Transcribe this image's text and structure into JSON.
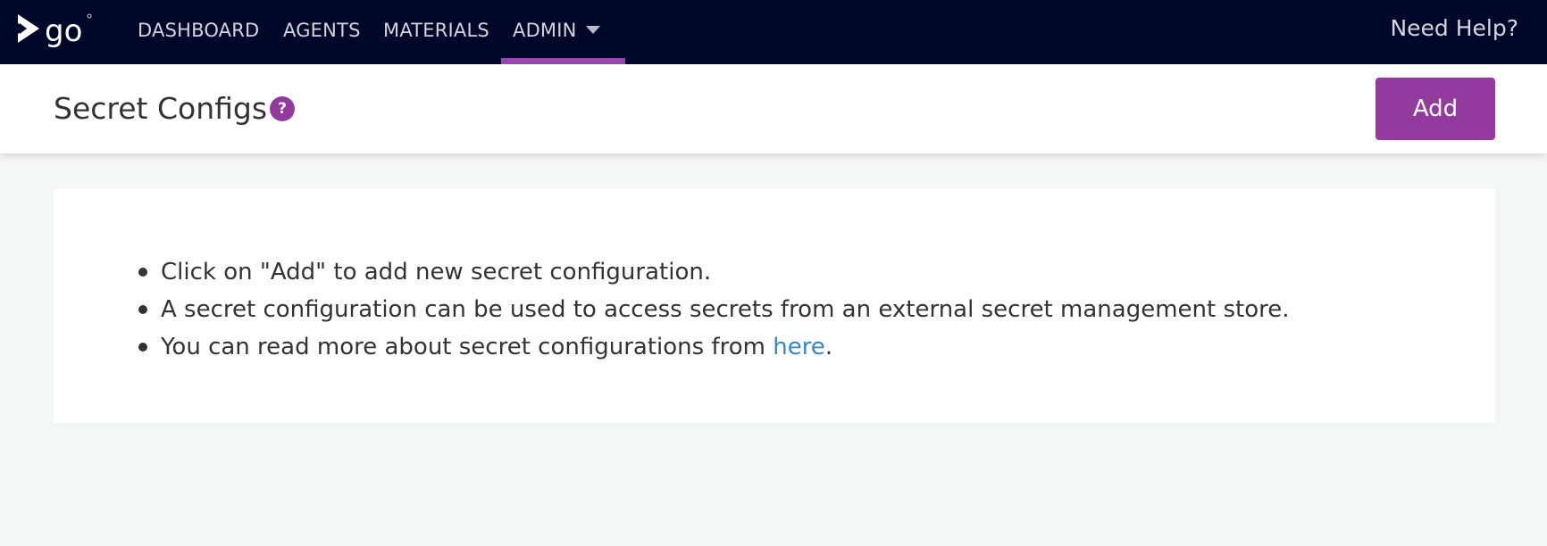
{
  "nav": {
    "logo_text": "go",
    "items": [
      {
        "label": "DASHBOARD"
      },
      {
        "label": "AGENTS"
      },
      {
        "label": "MATERIALS"
      },
      {
        "label": "ADMIN"
      }
    ],
    "help_label": "Need Help?",
    "accent_color": "#9a45b1",
    "background_color": "#000728"
  },
  "header": {
    "title": "Secret Configs",
    "help_badge": "?",
    "add_label": "Add",
    "brand_color": "#943a9e"
  },
  "info": {
    "line1": "Click on \"Add\" to add new secret configuration.",
    "line2": "A secret configuration can be used to access secrets from an external secret management store.",
    "line3_prefix": "You can read more about secret configurations from ",
    "line3_link": "here",
    "line3_suffix": ".",
    "link_color": "#3a87c1"
  }
}
